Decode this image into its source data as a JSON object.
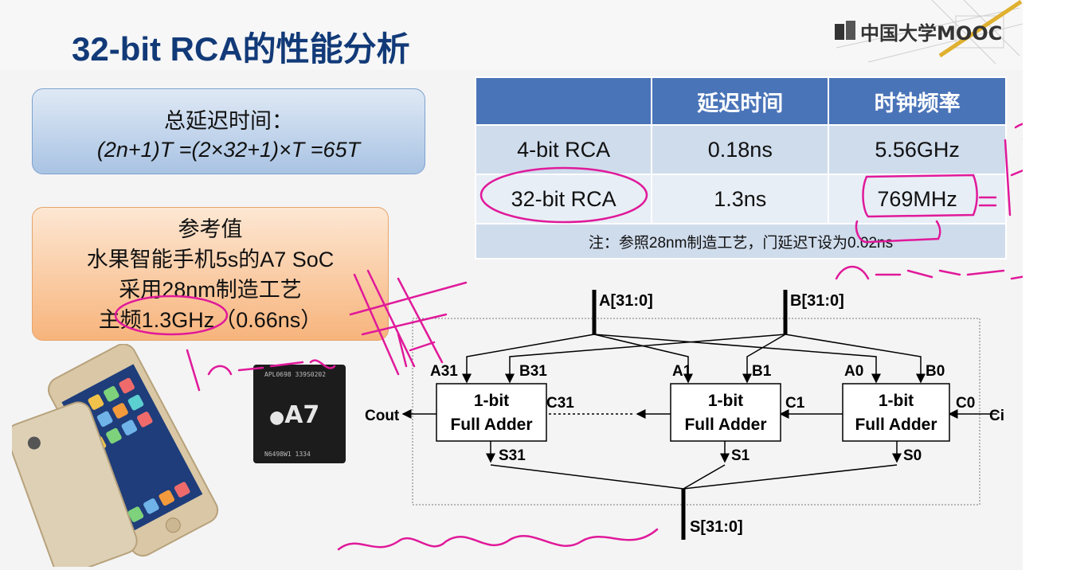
{
  "slide": {
    "title": "32-bit RCA的性能分析",
    "logo_text": "中国大学MOOC"
  },
  "delay_box": {
    "line1": "总延迟时间：",
    "line2": "(2n+1)T =(2×32+1)×T =65T"
  },
  "reference_box": {
    "line1": "参考值",
    "line2": "水果智能手机5s的A7 SoC",
    "line3": "采用28nm制造工艺",
    "line4": "主频1.3GHz（0.66ns）"
  },
  "table": {
    "headers": [
      "",
      "延迟时间",
      "时钟频率"
    ],
    "rows": [
      [
        "4-bit RCA",
        "0.18ns",
        "5.56GHz"
      ],
      [
        "32-bit RCA",
        "1.3ns",
        "769MHz"
      ]
    ],
    "note": "注：参照28nm制造工艺，门延迟T设为0.02ns"
  },
  "chip": {
    "label": "A7",
    "code_top": "APL0698 339S0202",
    "code_bottom": "N6498W1 1334"
  },
  "circuit": {
    "input_a": "A[31:0]",
    "input_b": "B[31:0]",
    "output_s": "S[31:0]",
    "cout": "Cout",
    "cin": "Cin",
    "adder_label_1": "1-bit",
    "adder_label_2": "Full Adder",
    "a31": "A31",
    "b31": "B31",
    "a1": "A1",
    "b1": "B1",
    "a0": "A0",
    "b0": "B0",
    "c31": "C31",
    "c1": "C1",
    "c0": "C0",
    "s31": "S31",
    "s1": "S1",
    "s0": "S0"
  },
  "colors": {
    "title": "#123a78",
    "table_header": "#4a74b8",
    "table_row_dark": "#cfdcec",
    "table_row_light": "#e8eef6",
    "ink": "#e0199a"
  }
}
